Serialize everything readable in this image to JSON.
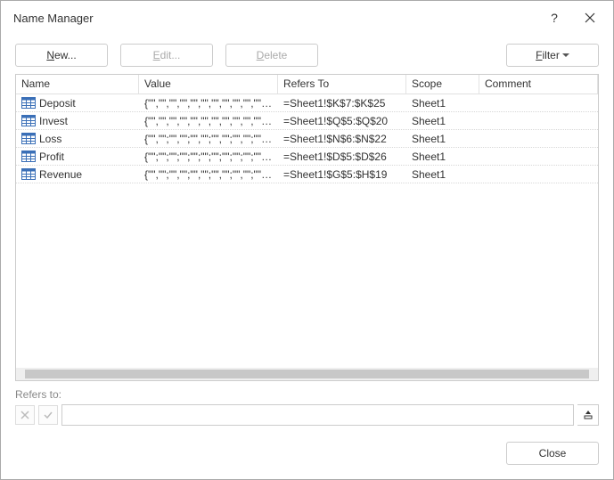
{
  "title": "Name Manager",
  "toolbar": {
    "new_prefix": "",
    "new_ul": "N",
    "new_suffix": "ew...",
    "edit_prefix": "",
    "edit_ul": "E",
    "edit_suffix": "dit...",
    "delete_prefix": "",
    "delete_ul": "D",
    "delete_suffix": "elete",
    "filter_prefix": "",
    "filter_ul": "F",
    "filter_suffix": "ilter"
  },
  "columns": {
    "name": "Name",
    "value": "Value",
    "refers": "Refers To",
    "scope": "Scope",
    "comment": "Comment"
  },
  "rows": [
    {
      "name": "Deposit",
      "value": "{\"\",\"\",\"\",\"\",\"\",\"\",\"\",\"\",\"\",\"\",\"\",\"\",\"\",...}",
      "refers": "=Sheet1!$K$7:$K$25",
      "scope": "Sheet1",
      "comment": ""
    },
    {
      "name": "Invest",
      "value": "{\"\",\"\",\"\",\"\",\"\",\"\",\"\",\"\",\"\",\"\",\"\",\"\",\"\",...}",
      "refers": "=Sheet1!$Q$5:$Q$20",
      "scope": "Sheet1",
      "comment": ""
    },
    {
      "name": "Loss",
      "value": "{\"\",\"\";\"\",\"\";\"\",\"\";\"\",\"\";\"\",\"\";\"\",\"\";\"\",\"...",
      "refers": "=Sheet1!$N$6:$N$22",
      "scope": "Sheet1",
      "comment": ""
    },
    {
      "name": "Profit",
      "value": "{\"\";\"\";\"\";\"\";\"\";\"\";\"\";\"\";\"\";\"\";\"\";\"\";\"\";\"\";...",
      "refers": "=Sheet1!$D$5:$D$26",
      "scope": "Sheet1",
      "comment": ""
    },
    {
      "name": "Revenue",
      "value": "{\"\",\"\";\"\",\"\";\"\",\"\";\"\",\"\";\"\",\"\";\"\",\"\";\"\",\"...",
      "refers": "=Sheet1!$G$5:$H$19",
      "scope": "Sheet1",
      "comment": ""
    }
  ],
  "refers_label": "Refers to:",
  "refers_value": "",
  "close_label": "Close"
}
